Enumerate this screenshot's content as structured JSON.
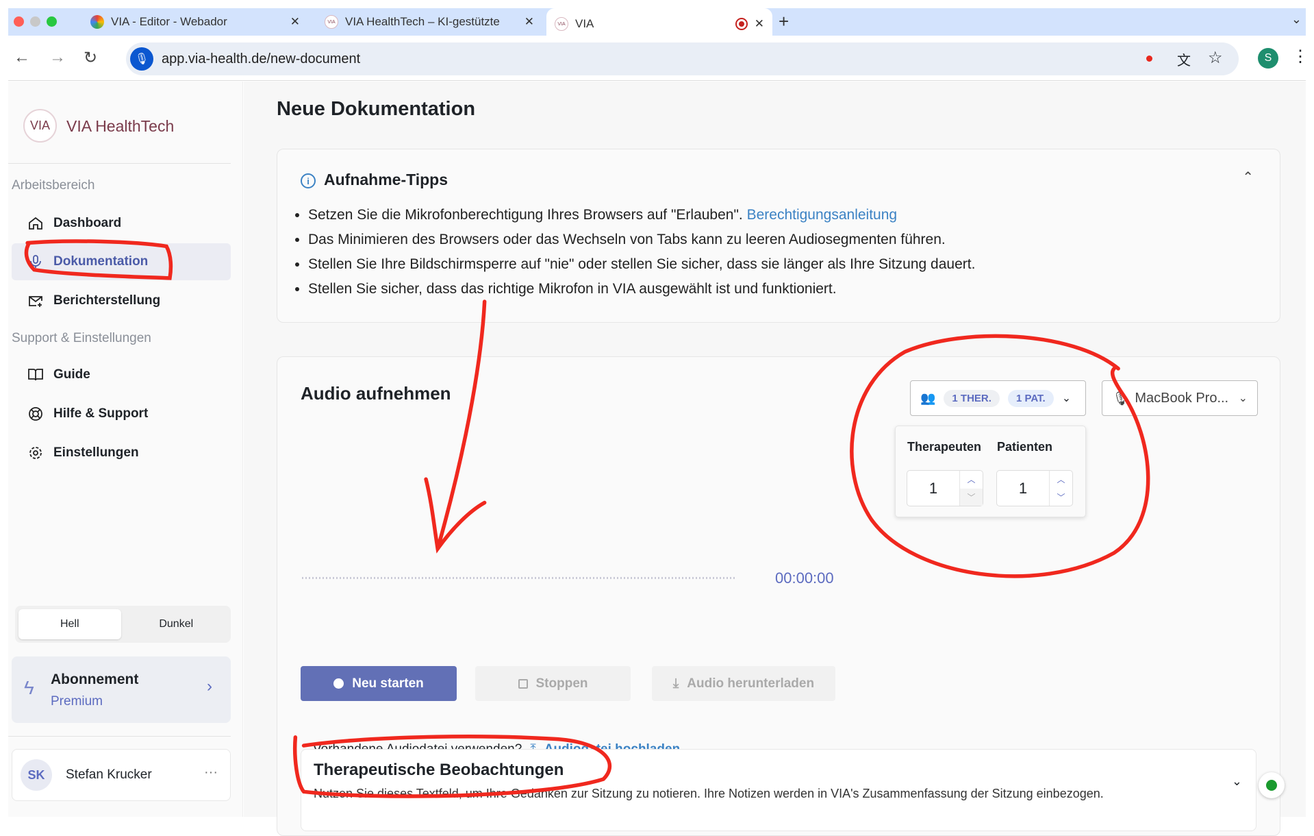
{
  "browser": {
    "tabs": [
      {
        "title": "VIA - Editor - Webador"
      },
      {
        "title": "VIA HealthTech – KI-gestützte"
      },
      {
        "title": "VIA"
      }
    ],
    "url": "app.via-health.de/new-document",
    "profile_initial": "S"
  },
  "sidebar": {
    "logo_text": "VIA",
    "brand": "VIA HealthTech",
    "section1": "Arbeitsbereich",
    "items1": [
      {
        "label": "Dashboard"
      },
      {
        "label": "Dokumentation"
      },
      {
        "label": "Berichterstellung"
      }
    ],
    "section2": "Support & Einstellungen",
    "items2": [
      {
        "label": "Guide"
      },
      {
        "label": "Hilfe & Support"
      },
      {
        "label": "Einstellungen"
      }
    ],
    "theme": {
      "light": "Hell",
      "dark": "Dunkel"
    },
    "subscription": {
      "title": "Abonnement",
      "plan": "Premium"
    },
    "user": {
      "initials": "SK",
      "name": "Stefan Krucker",
      "menu": "···"
    }
  },
  "main": {
    "title": "Neue Dokumentation",
    "tips": {
      "title": "Aufnahme-Tipps",
      "items": [
        "Setzen Sie die Mikrofonberechtigung Ihres Browsers auf \"Erlauben\".",
        "Das Minimieren des Browsers oder das Wechseln von Tabs kann zu leeren Audiosegmenten führen.",
        "Stellen Sie Ihre Bildschirmsperre auf \"nie\" oder stellen Sie sicher, dass sie länger als Ihre Sitzung dauert.",
        "Stellen Sie sicher, dass das richtige Mikrofon in VIA ausgewählt ist und funktioniert."
      ],
      "link": "Berechtigungsanleitung"
    },
    "audio": {
      "title": "Audio aufnehmen",
      "therapists_chip": "1 THER.",
      "patients_chip": "1 PAT.",
      "microphone": "MacBook Pro...",
      "popover": {
        "therapists_label": "Therapeuten",
        "patients_label": "Patienten",
        "therapists_value": "1",
        "patients_value": "1"
      },
      "timer": "00:00:00",
      "restart": "Neu starten",
      "stop": "Stoppen",
      "download": "Audio herunterladen",
      "existing_question": "Vorhandene Audiodatei verwenden?",
      "upload": "Audiodatei hochladen"
    },
    "observations": {
      "title": "Therapeutische Beobachtungen",
      "description": "Nutzen Sie dieses Textfeld, um Ihre Gedanken zur Sitzung zu notieren. Ihre Notizen werden in VIA's Zusammenfassung der Sitzung einbezogen."
    }
  },
  "colors": {
    "accent": "#5c6bc0",
    "link": "#3b82c4",
    "annotation": "#f0281e"
  }
}
